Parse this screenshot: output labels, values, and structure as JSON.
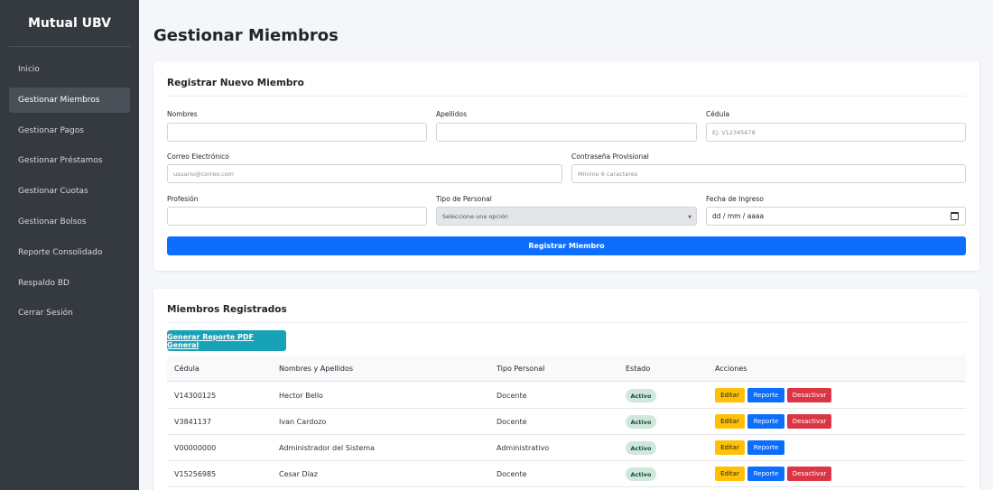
{
  "sidebar": {
    "brand": "Mutual UBV",
    "items": [
      {
        "label": "Inicio"
      },
      {
        "label": "Gestionar Miembros"
      },
      {
        "label": "Gestionar Pagos"
      },
      {
        "label": "Gestionar Préstamos"
      },
      {
        "label": "Gestionar Cuotas"
      },
      {
        "label": "Gestionar Bolsos"
      },
      {
        "label": "Reporte Consolidado"
      },
      {
        "label": "Respaldo BD"
      },
      {
        "label": "Cerrar Sesión"
      }
    ],
    "active_index": 1
  },
  "page": {
    "title": "Gestionar Miembros"
  },
  "form": {
    "title": "Registrar Nuevo Miembro",
    "nombres": {
      "label": "Nombres",
      "placeholder": ""
    },
    "apellidos": {
      "label": "Apellidos",
      "placeholder": ""
    },
    "cedula": {
      "label": "Cédula",
      "placeholder": "Ej: V12345678"
    },
    "correo": {
      "label": "Correo Electrónico",
      "placeholder": "usuario@correo.com"
    },
    "contrasena": {
      "label": "Contraseña Provisional",
      "placeholder": "Mínimo 6 caracteres"
    },
    "profesion": {
      "label": "Profesión",
      "placeholder": ""
    },
    "tipo": {
      "label": "Tipo de Personal",
      "value": "Seleccione una opción"
    },
    "fecha": {
      "label": "Fecha de Ingreso",
      "value": "dd / mm / aaaa"
    },
    "submit_label": "Registrar Miembro"
  },
  "members": {
    "title": "Miembros Registrados",
    "pdf_button": "Generar Reporte PDF General",
    "columns": [
      "Cédula",
      "Nombres y Apellidos",
      "Tipo Personal",
      "Estado",
      "Acciones"
    ],
    "rows": [
      {
        "cedula": "V14300125",
        "nombre": "Hector Bello",
        "tipo": "Docente",
        "estado": "Activo",
        "desactivar": true
      },
      {
        "cedula": "V3841137",
        "nombre": "Ivan Cardozo",
        "tipo": "Docente",
        "estado": "Activo",
        "desactivar": true
      },
      {
        "cedula": "V00000000",
        "nombre": "Administrador del Sistema",
        "tipo": "Administrativo",
        "estado": "Activo",
        "desactivar": false
      },
      {
        "cedula": "V15256985",
        "nombre": "Cesar Diaz",
        "tipo": "Docente",
        "estado": "Activo",
        "desactivar": true
      }
    ],
    "action_labels": {
      "edit": "Editar",
      "report": "Reporte",
      "deactivate": "Desactivar"
    }
  },
  "colors": {
    "sidebar_bg": "#343a40",
    "primary": "#0d6efd",
    "teal": "#17a2b8",
    "warning": "#ffc107",
    "danger": "#dc3545",
    "success_badge": "#d1e7dd"
  }
}
